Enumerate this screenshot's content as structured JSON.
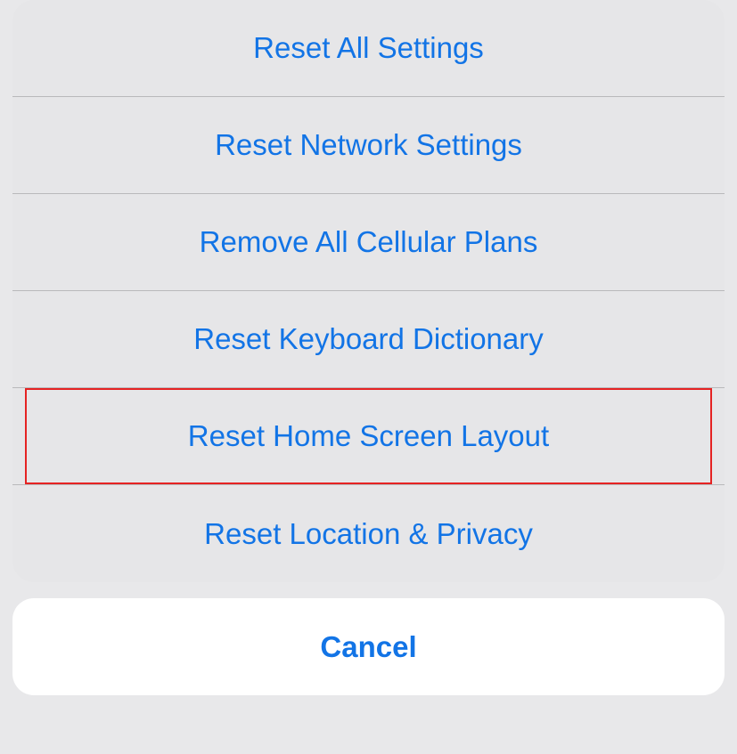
{
  "options": [
    "Reset All Settings",
    "Reset Network Settings",
    "Remove All Cellular Plans",
    "Reset Keyboard Dictionary",
    "Reset Home Screen Layout",
    "Reset Location & Privacy"
  ],
  "highlightedIndex": 4,
  "cancel": "Cancel"
}
